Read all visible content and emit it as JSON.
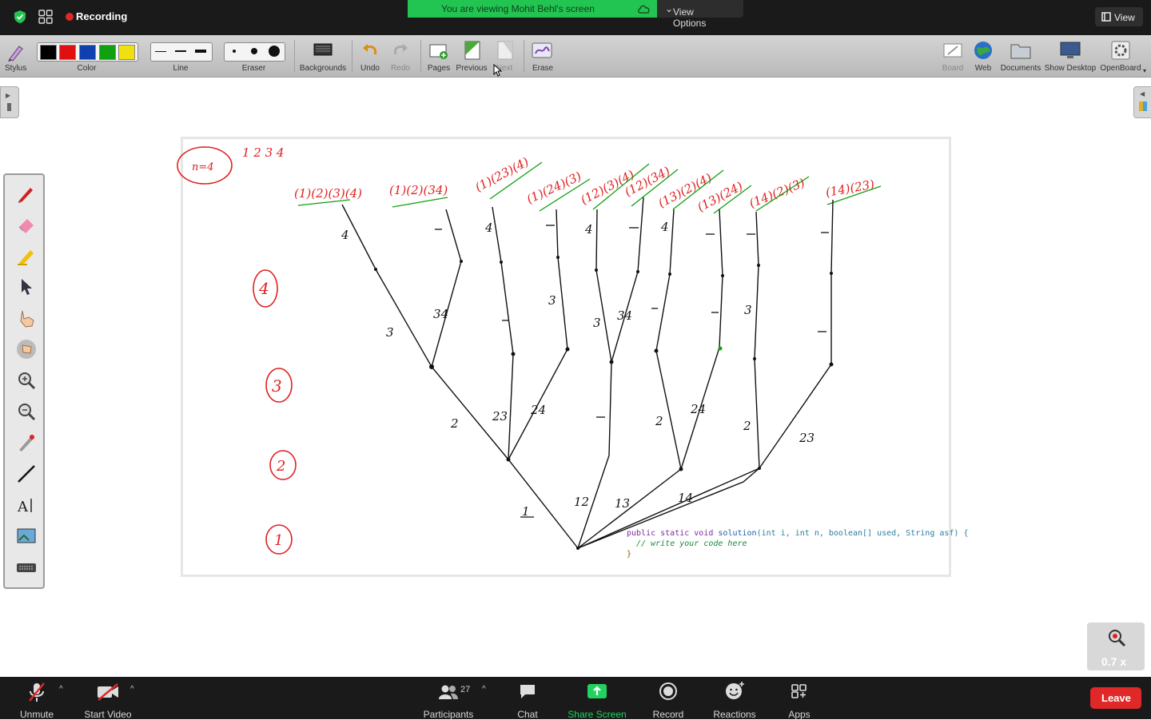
{
  "topbar": {
    "recording_label": "Recording",
    "viewing_banner": "You are viewing Mohit Behl's screen",
    "view_options_label": "View Options",
    "view_button_label": "View"
  },
  "toolbar": {
    "stylus": "Stylus",
    "color": "Color",
    "line": "Line",
    "eraser": "Eraser",
    "backgrounds": "Backgrounds",
    "undo": "Undo",
    "redo": "Redo",
    "pages": "Pages",
    "previous": "Previous",
    "next": "Next",
    "erase": "Erase",
    "board": "Board",
    "web": "Web",
    "documents": "Documents",
    "show_desktop": "Show Desktop",
    "openboard": "OpenBoard",
    "colors": [
      "#000000",
      "#e01010",
      "#1040b0",
      "#10a010",
      "#f0e010"
    ]
  },
  "board": {
    "n_label": "n=4",
    "top_numbers": "1  2  3  4",
    "level_labels": [
      "4",
      "3",
      "2",
      "1"
    ],
    "partitions": [
      "(1)(2)(3)(4)",
      "(1)(2)(34)",
      "(1)(23)(4)",
      "(1)(24)(3)",
      "(12)(3)(4)",
      "(12)(34)",
      "(13)(2)(4)",
      "(13)(24)",
      "(14)(2)(3)",
      "(14)(23)"
    ],
    "code_line1_kw": "public static void",
    "code_line1_fn": "solution",
    "code_line1_args": "(int i, int n, boolean[] used, String asf) {",
    "code_line2": "// write your code here",
    "code_line3": "}"
  },
  "zoom": {
    "level": "0.7 x"
  },
  "bottombar": {
    "unmute": "Unmute",
    "start_video": "Start Video",
    "participants": "Participants",
    "participant_count": "27",
    "chat": "Chat",
    "share_screen": "Share Screen",
    "record": "Record",
    "reactions": "Reactions",
    "apps": "Apps",
    "leave": "Leave"
  }
}
